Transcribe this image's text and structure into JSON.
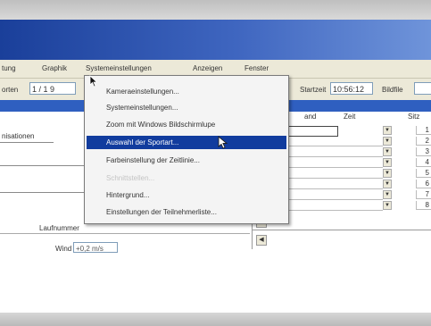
{
  "menubar": {
    "items": [
      "tung",
      "Graphik",
      "Systemeinstellungen",
      "Anzeigen",
      "Fenster"
    ]
  },
  "toolbar": {
    "left_label": "orten",
    "left_value": "1 / 1 9",
    "right_label": "Startzeit",
    "time_value": "10:56:12",
    "bildfile_label": "Bildfile"
  },
  "left_panel": {
    "heading": "nisationen",
    "laufnummer_label": "Laufnummer",
    "wind_label": "Wind",
    "wind_value": "+0,2 m/s"
  },
  "grid": {
    "headers": [
      "and",
      "Zeit",
      "Sitz"
    ],
    "rows": [
      {
        "num": "1"
      },
      {
        "num": "2"
      },
      {
        "num": "3"
      },
      {
        "num": "4"
      },
      {
        "num": "5"
      },
      {
        "num": "6"
      },
      {
        "num": "7"
      },
      {
        "num": "8"
      }
    ],
    "row_labels": [
      "",
      "",
      "",
      "",
      "",
      "6",
      "7",
      "8"
    ]
  },
  "dropdown_menu": {
    "items": [
      {
        "label": "Kameraeinstellungen...",
        "state": "normal"
      },
      {
        "label": "Systemeinstellungen...",
        "state": "normal"
      },
      {
        "label": "Zoom mit Windows Bildschirmlupe",
        "state": "normal"
      },
      {
        "label": "Auswahl der Sportart...",
        "state": "highlighted"
      },
      {
        "label": "Farbeinstellung der Zeitlinie...",
        "state": "normal"
      },
      {
        "label": "Schnittstellen...",
        "state": "disabled"
      },
      {
        "label": "Hintergrund...",
        "state": "normal"
      },
      {
        "label": "Einstellungen der Teilnehmerliste...",
        "state": "normal"
      }
    ]
  },
  "colors": {
    "title_blue": "#2f5fc0",
    "highlight": "#113c9e",
    "menu_bg": "#ece9d8"
  },
  "icons": {
    "arrow_cursor": "arrow-cursor-icon",
    "hand_cursor": "hand-cursor-icon",
    "dropdown_arrow": "triangle-down"
  }
}
